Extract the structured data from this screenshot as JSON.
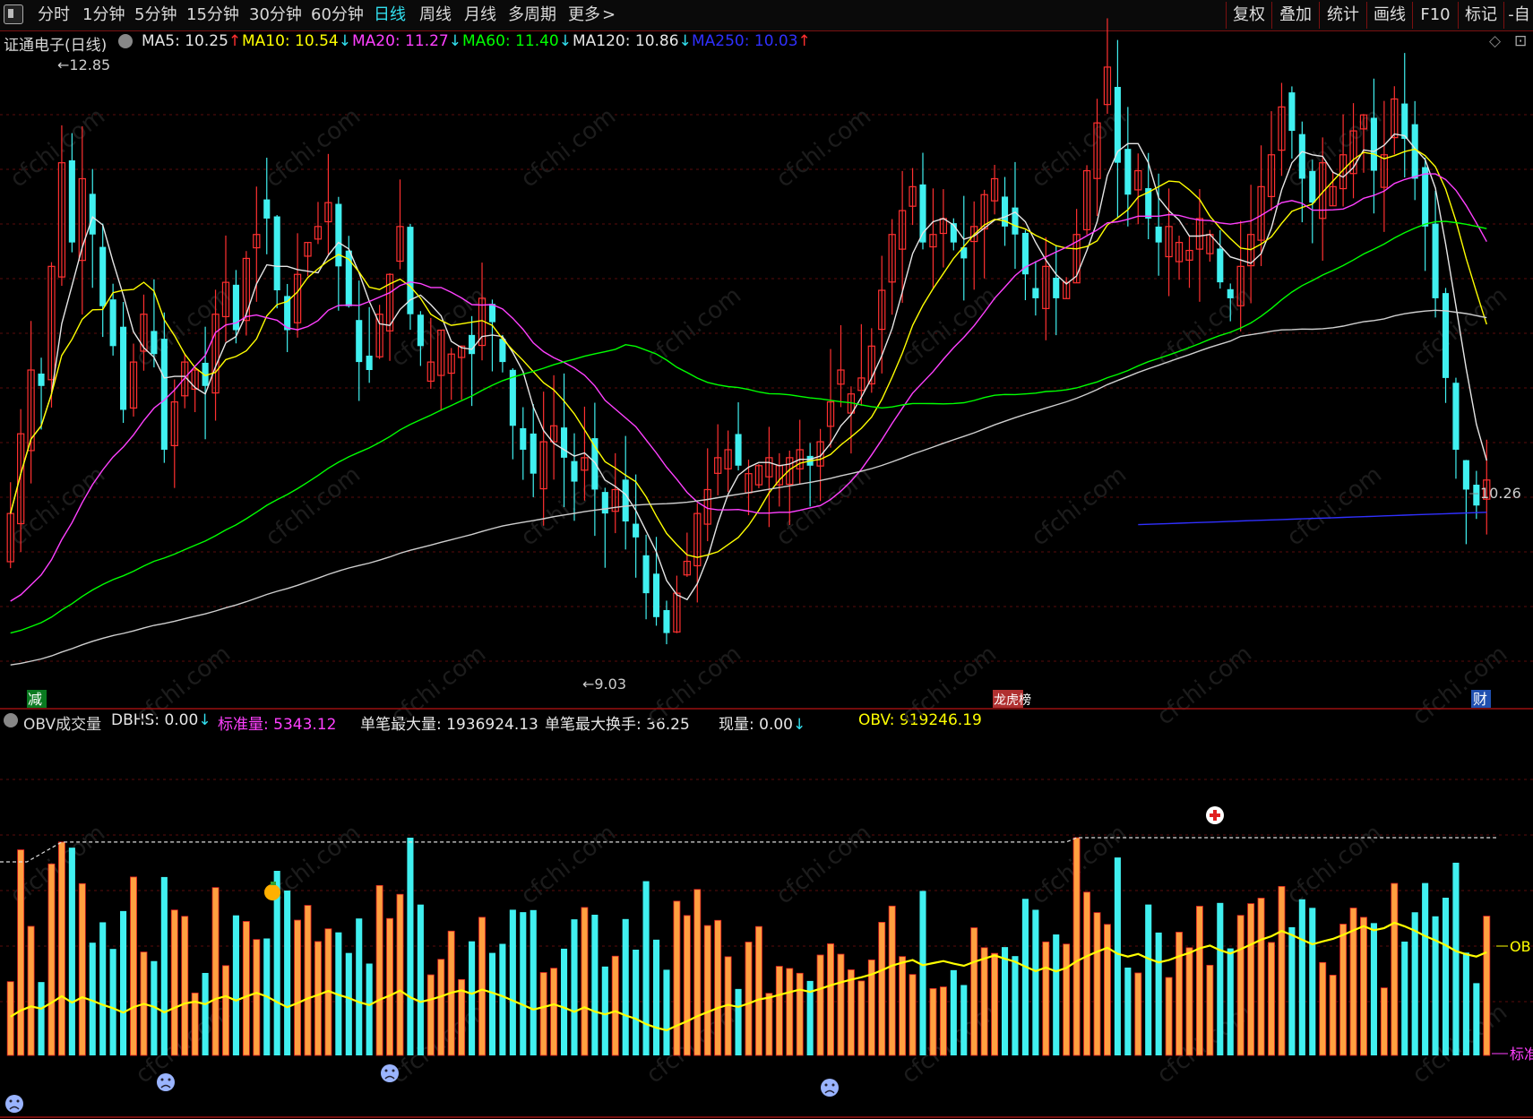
{
  "toolbar": {
    "menu_icon": "menu-square-icon",
    "periods": [
      "分时",
      "1分钟",
      "5分钟",
      "15分钟",
      "30分钟",
      "60分钟",
      "日线",
      "周线",
      "月线",
      "多周期",
      "更多"
    ],
    "active_period": "日线",
    "right_buttons": [
      "复权",
      "叠加",
      "统计",
      "画线",
      "F10",
      "标记",
      "-自"
    ]
  },
  "main_chart": {
    "title": "证通电子(日线)",
    "indicators": [
      {
        "label": "MA5: 10.25",
        "arrow": "↑",
        "color": "#e6e6e6",
        "arrow_color": "#ff3030"
      },
      {
        "label": "MA10: 10.54",
        "arrow": "↓",
        "color": "#ffff00",
        "arrow_color": "#32e0f0"
      },
      {
        "label": "MA20: 11.27",
        "arrow": "↓",
        "color": "#ff40ff",
        "arrow_color": "#32e0f0"
      },
      {
        "label": "MA60: 11.40",
        "arrow": "↓",
        "color": "#00ff00",
        "arrow_color": "#32e0f0"
      },
      {
        "label": "MA120: 10.86",
        "arrow": "↓",
        "color": "#e6e6e6",
        "arrow_color": "#32e0f0"
      },
      {
        "label": "MA250: 10.03",
        "arrow": "↑",
        "color": "#3030ff",
        "arrow_color": "#ff3030"
      }
    ],
    "high_label": "12.85",
    "low_label": "9.03",
    "price_tag": "10.26",
    "markers": [
      "减",
      "龙虎榜",
      "财"
    ]
  },
  "sub_chart": {
    "title": "OBV成交量",
    "indicators": [
      {
        "label": "DBHS: 0.00",
        "arrow": "↓",
        "color": "#e6e6e6",
        "arrow_color": "#32e0f0"
      },
      {
        "label": "标准量: 5343.12",
        "arrow": "",
        "color": "#ff40ff",
        "arrow_color": ""
      },
      {
        "label": "单笔最大量: 1936924.13",
        "arrow": "",
        "color": "#e6e6e6",
        "arrow_color": ""
      },
      {
        "label": "单笔最大换手: 36.25",
        "arrow": "",
        "color": "#e6e6e6",
        "arrow_color": ""
      },
      {
        "label": "现量: 0.00",
        "arrow": "↓",
        "color": "#e6e6e6",
        "arrow_color": "#32e0f0"
      },
      {
        "label": "OBV: 919246.19",
        "arrow": "",
        "color": "#ffff00",
        "arrow_color": ""
      }
    ],
    "right_tags": [
      "OB",
      "标准"
    ]
  },
  "colors": {
    "up": "#ff3030",
    "down": "#40f0f0",
    "ma5": "#e6e6e6",
    "ma10": "#ffff00",
    "ma20": "#ff40ff",
    "ma60": "#00ff00",
    "ma120": "#cfcfcf",
    "ma250": "#3030ff",
    "obv": "#ffff00",
    "vol_up": "#ffa040",
    "vol_down": "#40f0f0"
  },
  "chart_data": {
    "type": "candlestick",
    "close": [
      10.05,
      10.55,
      10.95,
      10.85,
      11.6,
      12.25,
      11.75,
      12.15,
      11.8,
      11.35,
      11.1,
      10.7,
      11.0,
      11.3,
      11.05,
      10.45,
      10.75,
      11.0,
      10.95,
      10.85,
      11.3,
      11.5,
      11.2,
      11.65,
      11.8,
      11.9,
      11.45,
      11.2,
      11.55,
      11.75,
      11.85,
      12.0,
      11.6,
      11.35,
      11.0,
      10.95,
      11.3,
      11.55,
      11.85,
      11.3,
      11.1,
      11.0,
      11.2,
      11.05,
      11.1,
      11.05,
      11.4,
      11.25,
      11.0,
      10.6,
      10.45,
      10.3,
      10.5,
      10.6,
      10.4,
      10.25,
      10.4,
      10.2,
      10.05,
      10.2,
      10.0,
      9.9,
      9.55,
      9.4,
      9.3,
      9.55,
      9.75,
      10.05,
      10.2,
      10.4,
      10.45,
      10.35,
      10.3,
      10.35,
      10.4,
      10.35,
      10.4,
      10.45,
      10.35,
      10.5,
      10.75,
      10.95,
      10.8,
      10.9,
      11.1,
      11.45,
      11.8,
      11.95,
      12.1,
      11.75,
      11.8,
      11.9,
      11.75,
      11.65,
      11.85,
      12.05,
      12.15,
      11.85,
      11.8,
      11.55,
      11.4,
      11.6,
      11.4,
      11.5,
      11.8,
      12.2,
      12.5,
      12.85,
      12.25,
      12.05,
      12.2,
      11.9,
      11.75,
      11.85,
      11.75,
      11.7,
      11.9,
      11.8,
      11.5,
      11.4,
      11.6,
      11.8,
      12.1,
      12.3,
      12.6,
      12.45,
      12.15,
      12.0,
      12.25,
      12.1,
      12.3,
      12.45,
      12.55,
      12.2,
      12.3,
      12.65,
      12.4,
      12.15,
      11.85,
      11.4,
      10.9,
      10.45,
      10.2,
      10.1,
      10.26
    ],
    "ma": {
      "MA5": 10.25,
      "MA10": 10.54,
      "MA20": 11.27,
      "MA60": 11.4,
      "MA120": 10.86,
      "MA250": 10.03
    },
    "price_range": [
      9.0,
      12.9
    ],
    "volume_label": "OBV成交量",
    "obv_last": 919246.19,
    "standard_volume": 5343.12
  }
}
